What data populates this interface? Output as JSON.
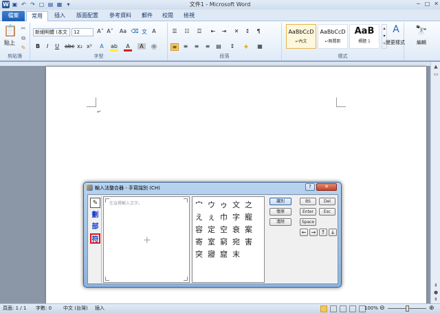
{
  "window": {
    "title": "文件1 - Microsoft Word",
    "minimize": "−",
    "maximize": "□",
    "close": "✕"
  },
  "tabs": [
    "檔案",
    "常用",
    "插入",
    "版面配置",
    "參考資料",
    "郵件",
    "校閱",
    "檢視"
  ],
  "ribbon": {
    "paste_label": "貼上",
    "clipboard_label": "剪貼簿",
    "font_name": "新細明體 (本文",
    "font_size": "12",
    "font_label": "字型",
    "paragraph_label": "段落",
    "styles": [
      {
        "preview": "AaBbCcD",
        "name": "↵內文"
      },
      {
        "preview": "AaBbCcD",
        "name": "↵無間距"
      },
      {
        "preview": "AaB",
        "name": "標題 1"
      }
    ],
    "styles_label": "樣式",
    "change_styles": "變更樣式",
    "edit_label": "編輯",
    "bold": "B",
    "italic": "I",
    "underline": "U"
  },
  "document": {
    "cursor_mark": "↵"
  },
  "ime": {
    "title": "輸入法整合器 - 手寫識別 (CH)",
    "side_items": [
      "劃",
      "部",
      "符"
    ],
    "canvas_placeholder": "在這裡輸入文字。",
    "candidates": [
      "宀",
      "ウ",
      "ゥ",
      "文",
      "之",
      "え",
      "ぇ",
      "巾",
      "字",
      "寵",
      "容",
      "定",
      "空",
      "衰",
      "案",
      "寄",
      "室",
      "窮",
      "宛",
      "害",
      "突",
      "寢",
      "窟",
      "末"
    ],
    "buttons": {
      "recognize": "識別",
      "undo": "復原",
      "clear": "清除",
      "bs": "BS",
      "del": "Del",
      "enter": "Enter",
      "esc": "Esc",
      "space": "Space"
    },
    "arrows": [
      "←",
      "→",
      "↑",
      "↓"
    ]
  },
  "status": {
    "page": "頁面: 1 / 1",
    "words": "字數: 0",
    "lang": "中文 (台灣)",
    "insert": "插入",
    "zoom": "100%"
  }
}
